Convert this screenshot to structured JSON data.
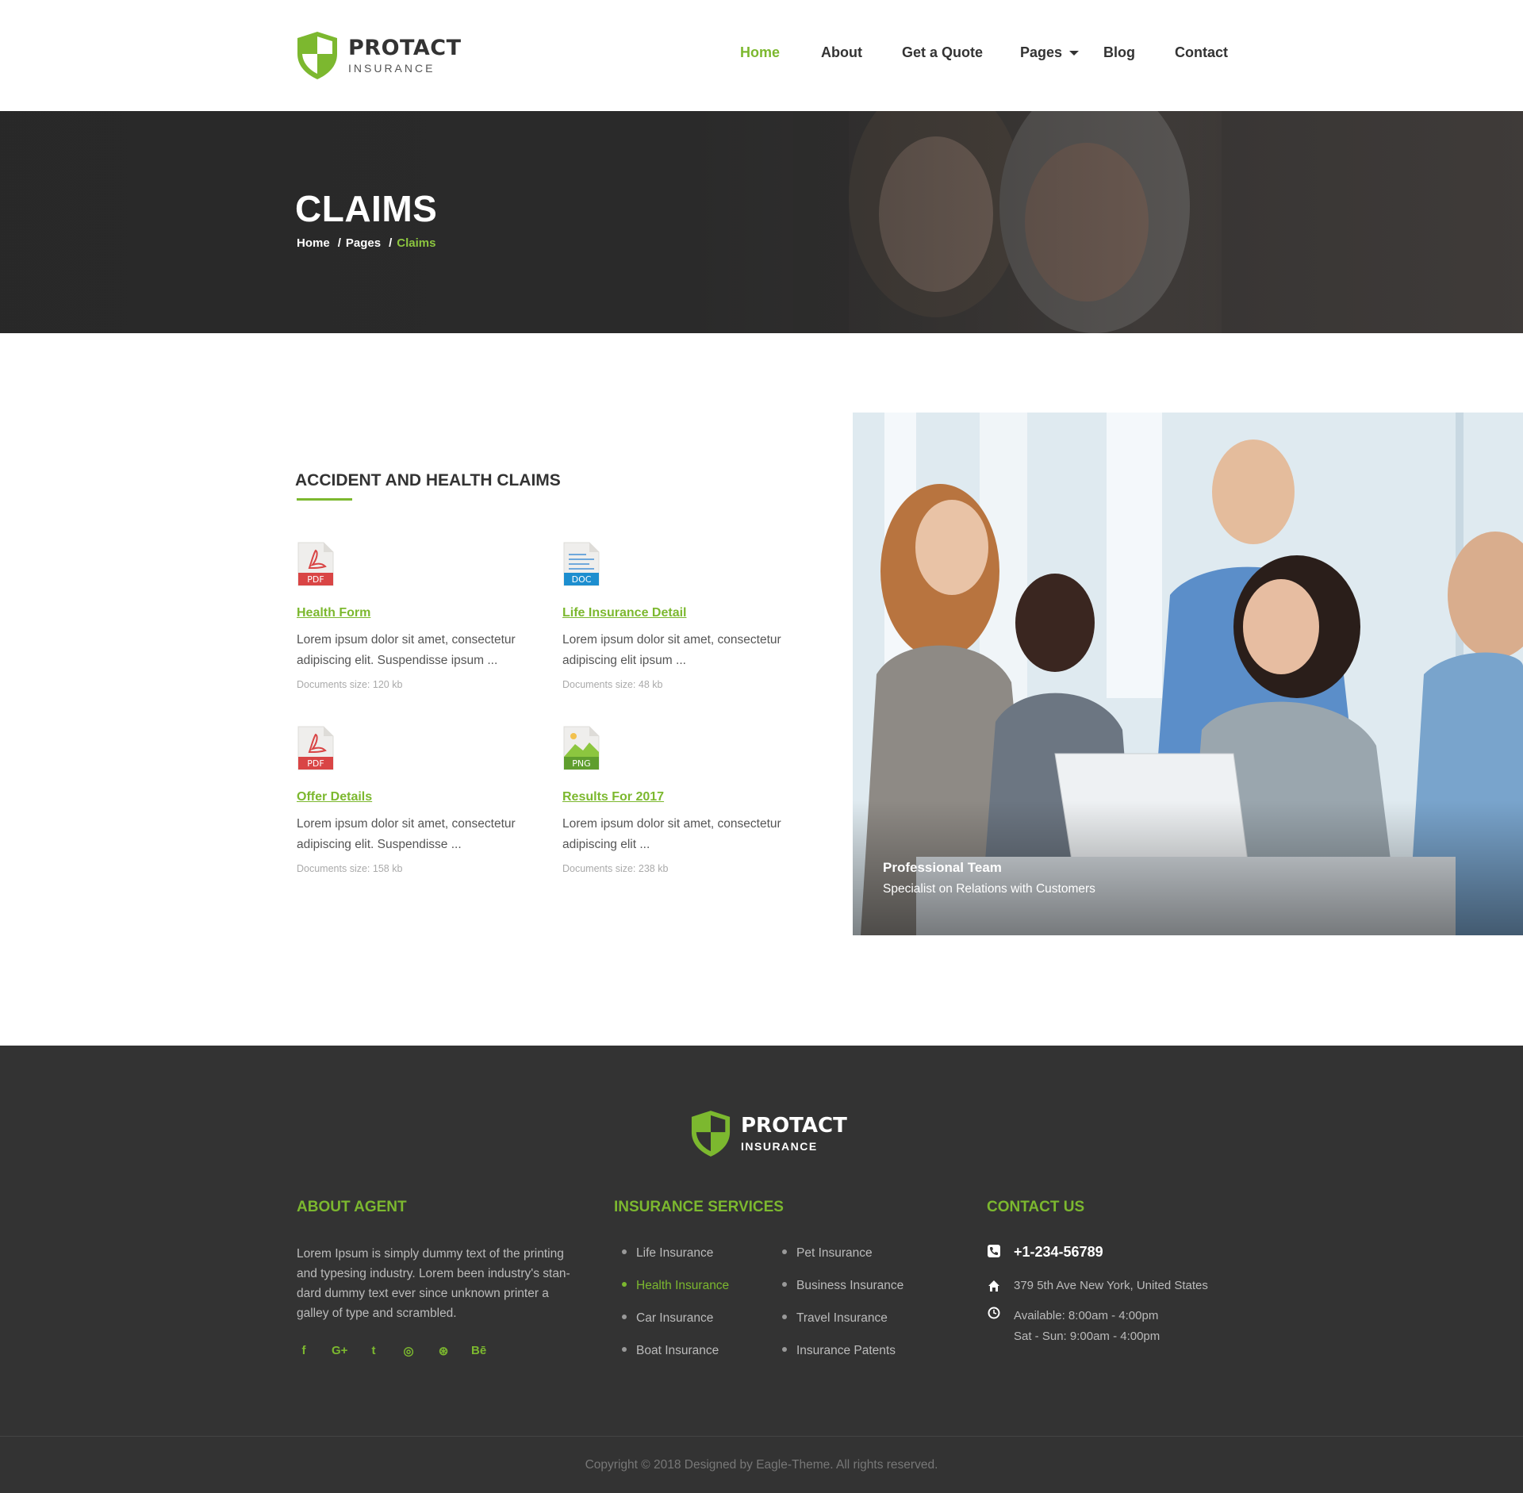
{
  "brand": {
    "name": "PROTACT",
    "tagline": "INSURANCE"
  },
  "nav": {
    "home": "Home",
    "about": "About",
    "quote": "Get a Quote",
    "pages": "Pages",
    "blog": "Blog",
    "contact": "Contact"
  },
  "banner": {
    "title": "CLAIMS",
    "breadcrumb": [
      "Home",
      "Pages",
      "Claims"
    ],
    "separator": "/"
  },
  "section": {
    "title": "ACCIDENT AND HEALTH CLAIMS",
    "documents": [
      {
        "type": "PDF",
        "title": "Health Form",
        "description": "Lorem ipsum dolor sit amet, consectetur adipiscing elit. Suspendisse ipsum ...",
        "size": "Documents size: 120 kb"
      },
      {
        "type": "DOC",
        "title": "Life Insurance Detail",
        "description": "Lorem ipsum dolor sit amet, consectetur adipiscing elit ipsum ...",
        "size": "Documents size: 48 kb"
      },
      {
        "type": "PDF",
        "title": "Offer Details",
        "description": "Lorem ipsum dolor sit amet, consectetur adipiscing elit. Suspendisse ...",
        "size": "Documents size: 158 kb"
      },
      {
        "type": "PNG",
        "title": "Results For 2017",
        "description": "Lorem ipsum dolor sit amet, consectetur adipiscing elit ...",
        "size": "Documents size: 238 kb"
      }
    ]
  },
  "team_photo": {
    "caption_title": "Professional Team",
    "caption_subtitle": "Specialist on Relations with Customers"
  },
  "footer": {
    "about": {
      "heading": "ABOUT AGENT",
      "text": "Lorem Ipsum is simply dummy text of the printing and typesing industry. Lorem been industry's stan-dard dummy text ever since  unknown printer a galley of type and scrambled."
    },
    "social_icons": [
      "facebook-icon",
      "google-plus-icon",
      "twitter-icon",
      "instagram-icon",
      "dribbble-icon",
      "behance-icon"
    ],
    "social_glyphs": [
      "f",
      "G+",
      "t",
      "◎",
      "⊛",
      "Bē"
    ],
    "services": {
      "heading": "INSURANCE SERVICES",
      "items": [
        "Life Insurance",
        "Health Insurance",
        "Car Insurance",
        "Boat Insurance",
        "Pet Insurance",
        "Business Insurance",
        "Travel Insurance",
        "Insurance Patents"
      ],
      "active": "Health Insurance"
    },
    "contact": {
      "heading": "CONTACT US",
      "phone": "+1-234-56789",
      "address": "379 5th Ave New York, United States",
      "hours_weekday": "Available: 8:00am - 4:00pm",
      "hours_weekend": "Sat - Sun: 9:00am - 4:00pm"
    },
    "copyright": "Copyright © 2018 Designed by Eagle-Theme. All rights reserved."
  },
  "colors": {
    "accent": "#7cb82f",
    "footer_bg": "#333333",
    "banner_bg": "#2f2f2f"
  }
}
